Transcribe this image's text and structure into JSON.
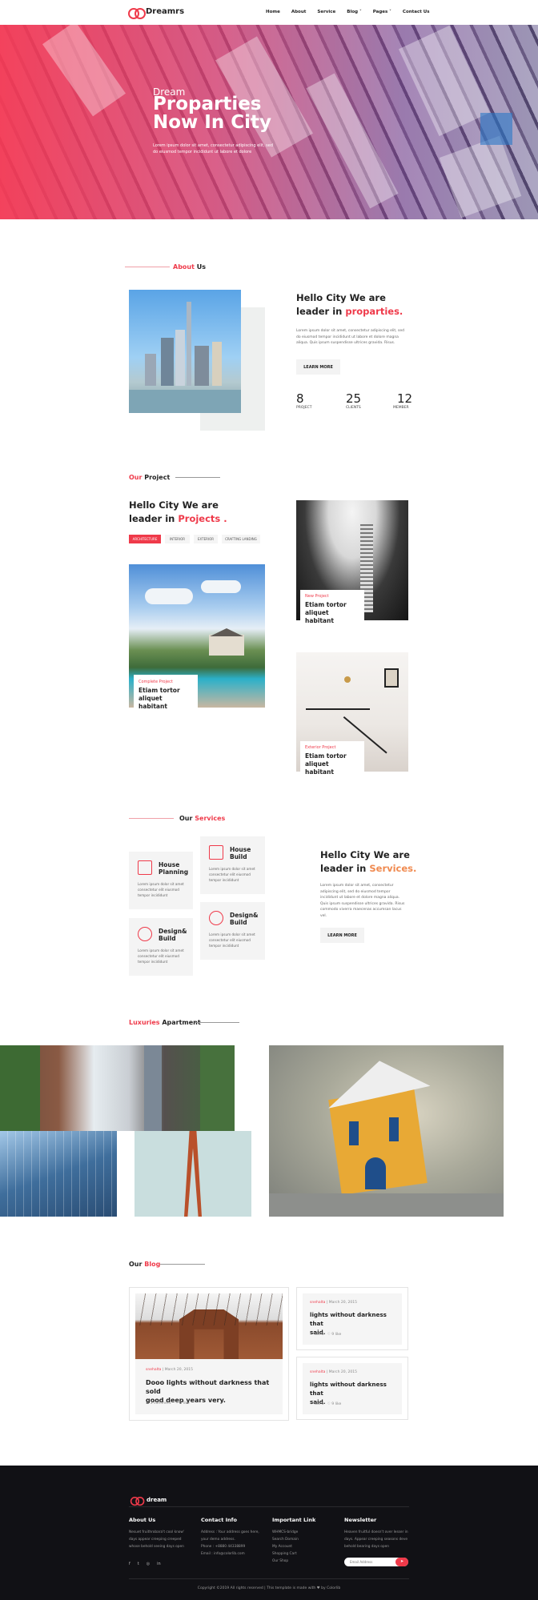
{
  "nav": {
    "brand": "Dreamrs",
    "items": [
      "Home",
      "About",
      "Service",
      "Blog ˅",
      "Pages ˅",
      "Contact Us"
    ]
  },
  "hero": {
    "subtitle": "Dream",
    "title_line1": "Proparties",
    "title_line2": "Now In City",
    "text": "Lorem ipsum dolor sit amet, consectetur adipiscing elit, sed do eiusmod tempor incididunt ut labore et dolore"
  },
  "about": {
    "label_red": "About",
    "label_dark": "Us",
    "heading_line1": "Hello City We are",
    "heading_line2_dark": "leader in",
    "heading_line2_red": "proparties.",
    "text": "Lorem ipsum dolor sit amet, consectetur adipiscing elit, sed do eiusmod tempor incididunt ut labore et dolore magna aliqua. Quis ipsum suspendisse ultrices gravida. Risus.",
    "button": "LEARN MORE",
    "stats": [
      {
        "value": "8",
        "label": "PROJECT"
      },
      {
        "value": "25",
        "label": "CLIENTS"
      },
      {
        "value": "12",
        "label": "MEMBER"
      }
    ]
  },
  "projects": {
    "label_red": "Our",
    "label_dark": "Project",
    "heading_line1": "Hello City We are",
    "heading_line2_dark": "leader in",
    "heading_line2_red": "Projects .",
    "tabs": [
      "ARCHITECTURE",
      "INTERIOR",
      "EXTERIOR",
      "CRAFTING LANDING"
    ],
    "cards": [
      {
        "tag": "New Project",
        "title_line1": "Etiam tortor",
        "title_line2": "aliquet habitant"
      },
      {
        "tag": "Complete Project",
        "title_line1": "Etiam tortor",
        "title_line2": "aliquet habitant"
      },
      {
        "tag": "Exterior Project",
        "title_line1": "Etiam tortor",
        "title_line2": "aliquet habitant"
      }
    ]
  },
  "services": {
    "label_dark": "Our",
    "label_red": "Services",
    "heading_line1": "Hello City We are",
    "heading_line2_dark": "leader in",
    "heading_line2_red": "Services.",
    "text": "Lorem ipsum dolor sit amet, consectetur adipiscing elit, sed do eiusmod tempor incididunt ut labore et dolore magna aliqua. Quis ipsum suspendisse ultrices gravida. Risus commodo viverra maecenas accumsan lacus vel.",
    "button": "LEARN MORE",
    "items": [
      {
        "title_line1": "House",
        "title_line2": "Planning",
        "text": "Lorem ipsum dolor sit amet consectetur elit eiusmod tempor incididunt",
        "icon": "blueprint-icon"
      },
      {
        "title_line1": "House",
        "title_line2": "Build",
        "text": "Lorem ipsum dolor sit amet consectetur elit eiusmod tempor incididunt",
        "icon": "checklist-icon"
      },
      {
        "title_line1": "Design&",
        "title_line2": "Build",
        "text": "Lorem ipsum dolor sit amet consectetur elit eiusmod tempor incididunt",
        "icon": "rocket-icon"
      },
      {
        "title_line1": "Design&",
        "title_line2": "Build",
        "text": "Lorem ipsum dolor sit amet consectetur elit eiusmod tempor incididunt",
        "icon": "tools-icon"
      }
    ]
  },
  "apartment": {
    "label_red": "Luxuries",
    "label_dark": "Apartment"
  },
  "blog": {
    "label_dark": "Our",
    "label_red": "Blog",
    "main": {
      "author": "snehalta",
      "date": "March 20, 2015",
      "title_line1": "Dooo lights without darkness that sold",
      "title_line2": "good deep years very.",
      "comments": "3 comment",
      "likes": "5 like"
    },
    "side": [
      {
        "author": "snehalta",
        "date": "March 20, 2015",
        "title_line1": "lights without darkness that",
        "title_line2": "said.",
        "likes": "like 5",
        "favs": "9 like"
      },
      {
        "author": "snehalta",
        "date": "March 20, 2015",
        "title_line1": "lights without darkness that",
        "title_line2": "said.",
        "likes": "like 5",
        "favs": "9 like"
      }
    ]
  },
  "footer": {
    "brand": "dream",
    "about_title": "About Us",
    "about_text": "Nesuet fruithrobara't cool know' days appear creeping creeped whose behold seeing days open",
    "contact_title": "Contact Info",
    "contact_lines": [
      "Address : Your address goes here,",
      "your demo address.",
      "Phone : +8880 44338899",
      "Email : info@colorlib.com"
    ],
    "links_title": "Important Link",
    "links": [
      "WHMCS-bridge",
      "Search Domain",
      "My Account",
      "Shopping Cart",
      "Our Shop"
    ],
    "newsletter_title": "Newsletter",
    "newsletter_text": "Heaven fruitful doesn't over lesser in days. Appear creeping seasons deve behold bearing days open",
    "email_placeholder": "Email Address",
    "copyright": "Copyright ©2019 All rights reserved | This template is made with ♥ by Colorlib"
  }
}
